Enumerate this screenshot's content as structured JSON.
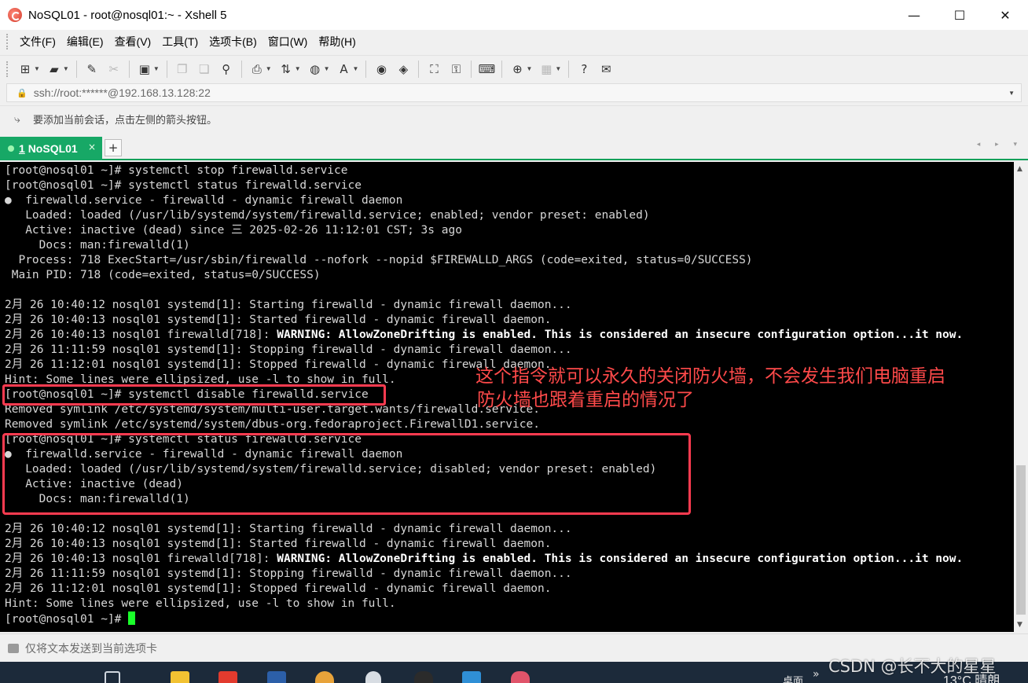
{
  "window": {
    "title": "NoSQL01 - root@nosql01:~ - Xshell 5",
    "controls": {
      "minimize": "—",
      "maximize": "☐",
      "close": "✕"
    }
  },
  "menu": [
    "文件(F)",
    "编辑(E)",
    "查看(V)",
    "工具(T)",
    "选项卡(B)",
    "窗口(W)",
    "帮助(H)"
  ],
  "toolbar": {
    "icons": [
      "new-session-icon",
      "open-folder-icon",
      "reconnect-icon",
      "disconnect-icon",
      "properties-icon",
      "copy-icon",
      "paste-icon",
      "find-icon",
      "print-icon",
      "transfer-icon",
      "globe-icon",
      "font-icon",
      "xftp-icon",
      "xagent-icon",
      "fullscreen-icon",
      "lock-icon",
      "keyboard-icon",
      "add-icon",
      "layout-icon",
      "help-icon",
      "chat-icon"
    ]
  },
  "address": {
    "lock_icon": "🔒",
    "text": "ssh://root:******@192.168.13.128:22"
  },
  "hint": {
    "text": "要添加当前会话，点击左侧的箭头按钮。"
  },
  "tabs": [
    {
      "number": "1",
      "label": "NoSQL01",
      "close": "×",
      "active": true
    }
  ],
  "tab_add": "+",
  "tab_nav": "◂ ▸ ▾",
  "terminal": {
    "lines": [
      "[root@nosql01 ~]# systemctl stop firewalld.service",
      "[root@nosql01 ~]# systemctl status firewalld.service",
      "●  firewalld.service - firewalld - dynamic firewall daemon",
      "   Loaded: loaded (/usr/lib/systemd/system/firewalld.service; enabled; vendor preset: enabled)",
      "   Active: inactive (dead) since 三 2025-02-26 11:12:01 CST; 3s ago",
      "     Docs: man:firewalld(1)",
      "  Process: 718 ExecStart=/usr/sbin/firewalld --nofork --nopid $FIREWALLD_ARGS (code=exited, status=0/SUCCESS)",
      " Main PID: 718 (code=exited, status=0/SUCCESS)",
      "",
      "2月 26 10:40:12 nosql01 systemd[1]: Starting firewalld - dynamic firewall daemon...",
      "2月 26 10:40:13 nosql01 systemd[1]: Started firewalld - dynamic firewall daemon.",
      "2月 26 10:40:13 nosql01 firewalld[718]: |WARNING: AllowZoneDrifting is enabled. This is considered an insecure configuration option...it now.",
      "2月 26 11:11:59 nosql01 systemd[1]: Stopping firewalld - dynamic firewall daemon...",
      "2月 26 11:12:01 nosql01 systemd[1]: Stopped firewalld - dynamic firewall daemon.",
      "Hint: Some lines were ellipsized, use -l to show in full.",
      "[root@nosql01 ~]# systemctl disable firewalld.service",
      "Removed symlink /etc/systemd/system/multi-user.target.wants/firewalld.service.",
      "Removed symlink /etc/systemd/system/dbus-org.fedoraproject.FirewallD1.service.",
      "[root@nosql01 ~]# systemctl status firewalld.service",
      "●  firewalld.service - firewalld - dynamic firewall daemon",
      "   Loaded: loaded (/usr/lib/systemd/system/firewalld.service; disabled; vendor preset: enabled)",
      "   Active: inactive (dead)",
      "     Docs: man:firewalld(1)",
      "",
      "2月 26 10:40:12 nosql01 systemd[1]: Starting firewalld - dynamic firewall daemon...",
      "2月 26 10:40:13 nosql01 systemd[1]: Started firewalld - dynamic firewall daemon.",
      "2月 26 10:40:13 nosql01 firewalld[718]: |WARNING: AllowZoneDrifting is enabled. This is considered an insecure configuration option...it now.",
      "2月 26 11:11:59 nosql01 systemd[1]: Stopping firewalld - dynamic firewall daemon...",
      "2月 26 11:12:01 nosql01 systemd[1]: Stopped firewalld - dynamic firewall daemon.",
      "Hint: Some lines were ellipsized, use -l to show in full."
    ],
    "prompt": "[root@nosql01 ~]# ",
    "cursor_color": "#1aff2a"
  },
  "annotation": {
    "line1": "这个指令就可以永久的关闭防火墙，不会发生我们电脑重启",
    "line2": "防火墙也跟着重启的情况了",
    "color": "#ff4a4a"
  },
  "sendbar": {
    "text": "仅将文本发送到当前选项卡"
  },
  "taskbar": {
    "tray_text": "桌面",
    "chevron": "»",
    "weather": "13°C  晴朗"
  },
  "watermark": "CSDN @长不大的星星"
}
